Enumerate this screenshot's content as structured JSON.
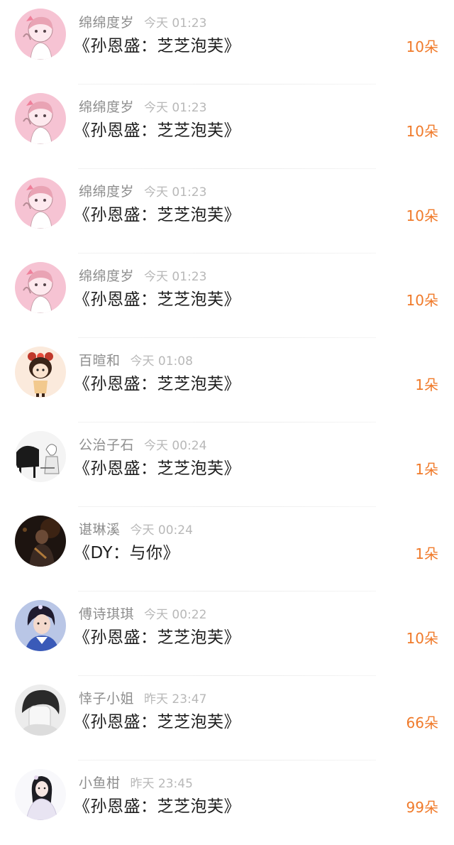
{
  "items": [
    {
      "name": "绵绵度岁",
      "time": "今天 01:23",
      "gift": "《孙恩盛：芝芝泡芙》",
      "count": "10朵",
      "avatar": "pink-girl-avatar"
    },
    {
      "name": "绵绵度岁",
      "time": "今天 01:23",
      "gift": "《孙恩盛：芝芝泡芙》",
      "count": "10朵",
      "avatar": "pink-girl-avatar"
    },
    {
      "name": "绵绵度岁",
      "time": "今天 01:23",
      "gift": "《孙恩盛：芝芝泡芙》",
      "count": "10朵",
      "avatar": "pink-girl-avatar"
    },
    {
      "name": "绵绵度岁",
      "time": "今天 01:23",
      "gift": "《孙恩盛：芝芝泡芙》",
      "count": "10朵",
      "avatar": "pink-girl-avatar"
    },
    {
      "name": "百暄和",
      "time": "今天 01:08",
      "gift": "《孙恩盛：芝芝泡芙》",
      "count": "1朵",
      "avatar": "cartoon-doll-avatar"
    },
    {
      "name": "公治子石",
      "time": "今天 00:24",
      "gift": "《孙恩盛：芝芝泡芙》",
      "count": "1朵",
      "avatar": "piano-sketch-avatar"
    },
    {
      "name": "谌琳溪",
      "time": "今天 00:24",
      "gift": "《DY：与你》",
      "count": "1朵",
      "avatar": "dark-warrior-avatar"
    },
    {
      "name": "傅诗琪琪",
      "time": "今天 00:22",
      "gift": "《孙恩盛：芝芝泡芙》",
      "count": "10朵",
      "avatar": "costume-portrait-avatar"
    },
    {
      "name": "悻子小姐",
      "time": "昨天 23:47",
      "gift": "《孙恩盛：芝芝泡芙》",
      "count": "66朵",
      "avatar": "hidden-face-avatar"
    },
    {
      "name": "小鱼柑",
      "time": "昨天 23:45",
      "gift": "《孙恩盛：芝芝泡芙》",
      "count": "99朵",
      "avatar": "white-dress-girl-avatar"
    }
  ],
  "colors": {
    "name": "#8e8e8e",
    "time": "#b8b8b8",
    "gift": "#1f1f1f",
    "count": "#f07a2a"
  }
}
